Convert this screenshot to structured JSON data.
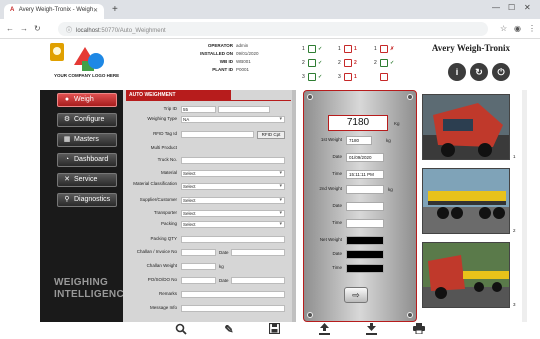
{
  "browser": {
    "tab_title": "Avery Weigh-Tronix - Weigh",
    "url_prefix": "localhost",
    "url_rest": ":50770/Auto_Weighment"
  },
  "header": {
    "company_name": "YOUR COMPANY LOGO HERE",
    "brand": "Avery Weigh-Tronix",
    "info": [
      {
        "label": "OPERATOR",
        "value": "admin"
      },
      {
        "label": "INSTALLED ON",
        "value": "09/01/2020"
      },
      {
        "label": "WB ID",
        "value": "WB001"
      },
      {
        "label": "PLANT ID",
        "value": "P0001"
      }
    ],
    "indicators": [
      [
        {
          "n": "1",
          "chk": "✓",
          "red": false
        },
        {
          "n": "1",
          "chk": "1",
          "red": true
        },
        {
          "n": "1",
          "chk": "✗",
          "red": true
        }
      ],
      [
        {
          "n": "2",
          "chk": "✓",
          "red": false
        },
        {
          "n": "2",
          "chk": "2",
          "red": true
        },
        {
          "n": "2",
          "chk": "✓",
          "red": false
        }
      ],
      [
        {
          "n": "3",
          "chk": "✓",
          "red": false
        },
        {
          "n": "3",
          "chk": "1",
          "red": true
        },
        {
          "n": "",
          "chk": "",
          "red": true
        }
      ]
    ]
  },
  "sidebar": {
    "items": [
      {
        "label": "Weigh",
        "icon": "●"
      },
      {
        "label": "Configure",
        "icon": "⚙"
      },
      {
        "label": "Masters",
        "icon": "▦"
      },
      {
        "label": "Dashboard",
        "icon": "◔"
      },
      {
        "label": "Service",
        "icon": "✕"
      },
      {
        "label": "Diagnostics",
        "icon": "⚲"
      }
    ],
    "footer_line1": "WEIGHING",
    "footer_line2": "INTELLIGENCE"
  },
  "form": {
    "title": "AUTO WEIGHMENT",
    "trip_id_label": "Trip ID",
    "trip_id_value": "55",
    "weighing_type_label": "Weighing Type",
    "weighing_type_value": "NA",
    "rfid_label": "RFID Tag Id",
    "rfid_button": "RFID Cpt",
    "multi_product_label": "Multi Product",
    "truck_no_label": "Truck No.",
    "material_label": "Material",
    "material_value": "Select",
    "material_class_label": "Material Classification",
    "material_class_value": "Select",
    "supplier_label": "Supplier/Customer",
    "supplier_value": "Select",
    "transporter_label": "Transporter",
    "transporter_value": "Select",
    "packing_label": "Packing",
    "packing_value": "Select",
    "packing_qty_label": "Packing QTY",
    "challan_label": "Challan / Invoice No",
    "date_label": "Date",
    "challan_weight_label": "Challan Weight",
    "kg": "kg",
    "po_label": "PO/SO/DO No",
    "remarks_label": "Remarks",
    "message_label": "Message Info"
  },
  "weight": {
    "display": "7180",
    "unit": "Kg",
    "first_weight_label": "1st Weight",
    "first_weight_value": "7180",
    "date_label": "Date",
    "first_date_value": "01/09/2020",
    "time_label": "Time",
    "first_time_value": "15:11:11 PM",
    "second_weight_label": "2nd Weight",
    "net_weight_label": "Net Weight",
    "kg": "kg",
    "go_icon": "⇨"
  },
  "photos": [
    {
      "index": "1"
    },
    {
      "index": "2"
    },
    {
      "index": "3"
    }
  ],
  "toolbar": {
    "items": [
      "search-icon",
      "edit-icon",
      "save-icon",
      "upload-icon",
      "download-icon",
      "print-icon"
    ]
  }
}
